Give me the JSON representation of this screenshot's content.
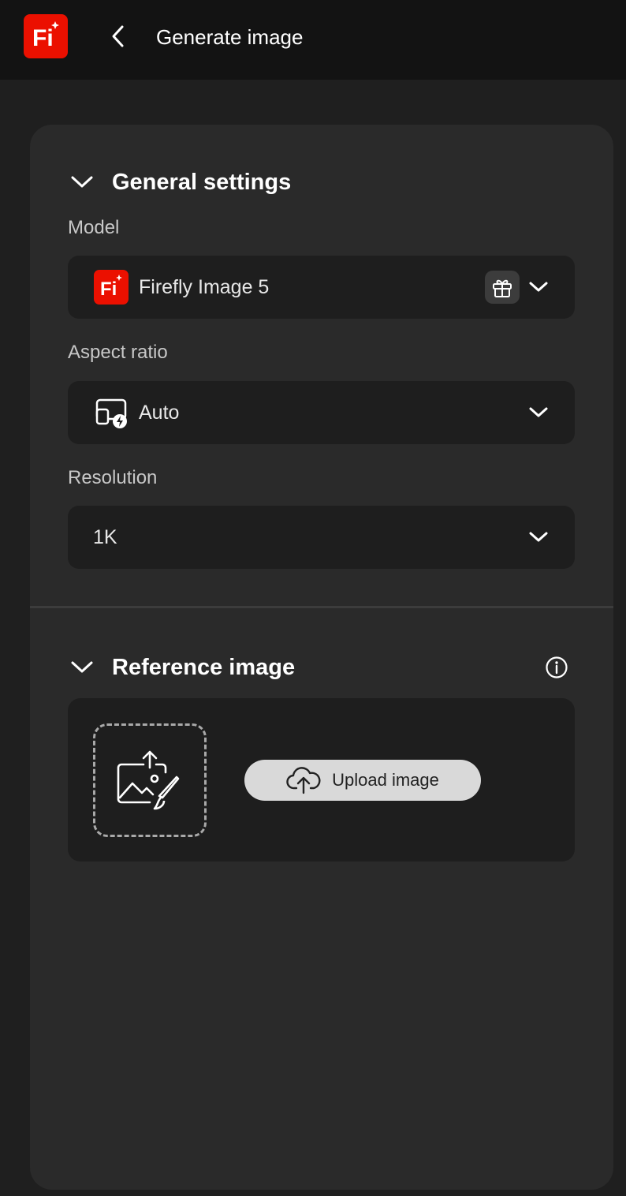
{
  "header": {
    "logo_text": "Fi",
    "title": "Generate image"
  },
  "general_settings": {
    "title": "General settings",
    "model": {
      "label": "Model",
      "value": "Firefly Image 5",
      "icon_text": "Fi"
    },
    "aspect_ratio": {
      "label": "Aspect ratio",
      "value": "Auto"
    },
    "resolution": {
      "label": "Resolution",
      "value": "1K"
    }
  },
  "reference_image": {
    "title": "Reference image",
    "upload_label": "Upload image"
  },
  "icons": {
    "back": "chevron-left-icon",
    "collapse": "chevron-down-icon",
    "gift": "gift-icon",
    "aspect": "aspect-ratio-auto-icon",
    "info": "info-icon",
    "image_upload": "image-upload-icon",
    "cloud_upload": "cloud-upload-icon"
  },
  "colors": {
    "brand": "#eb1000",
    "background": "#1f1f1f",
    "panel": "#2a2a2a",
    "field": "#1e1e1e",
    "button": "#d9d9d9"
  }
}
